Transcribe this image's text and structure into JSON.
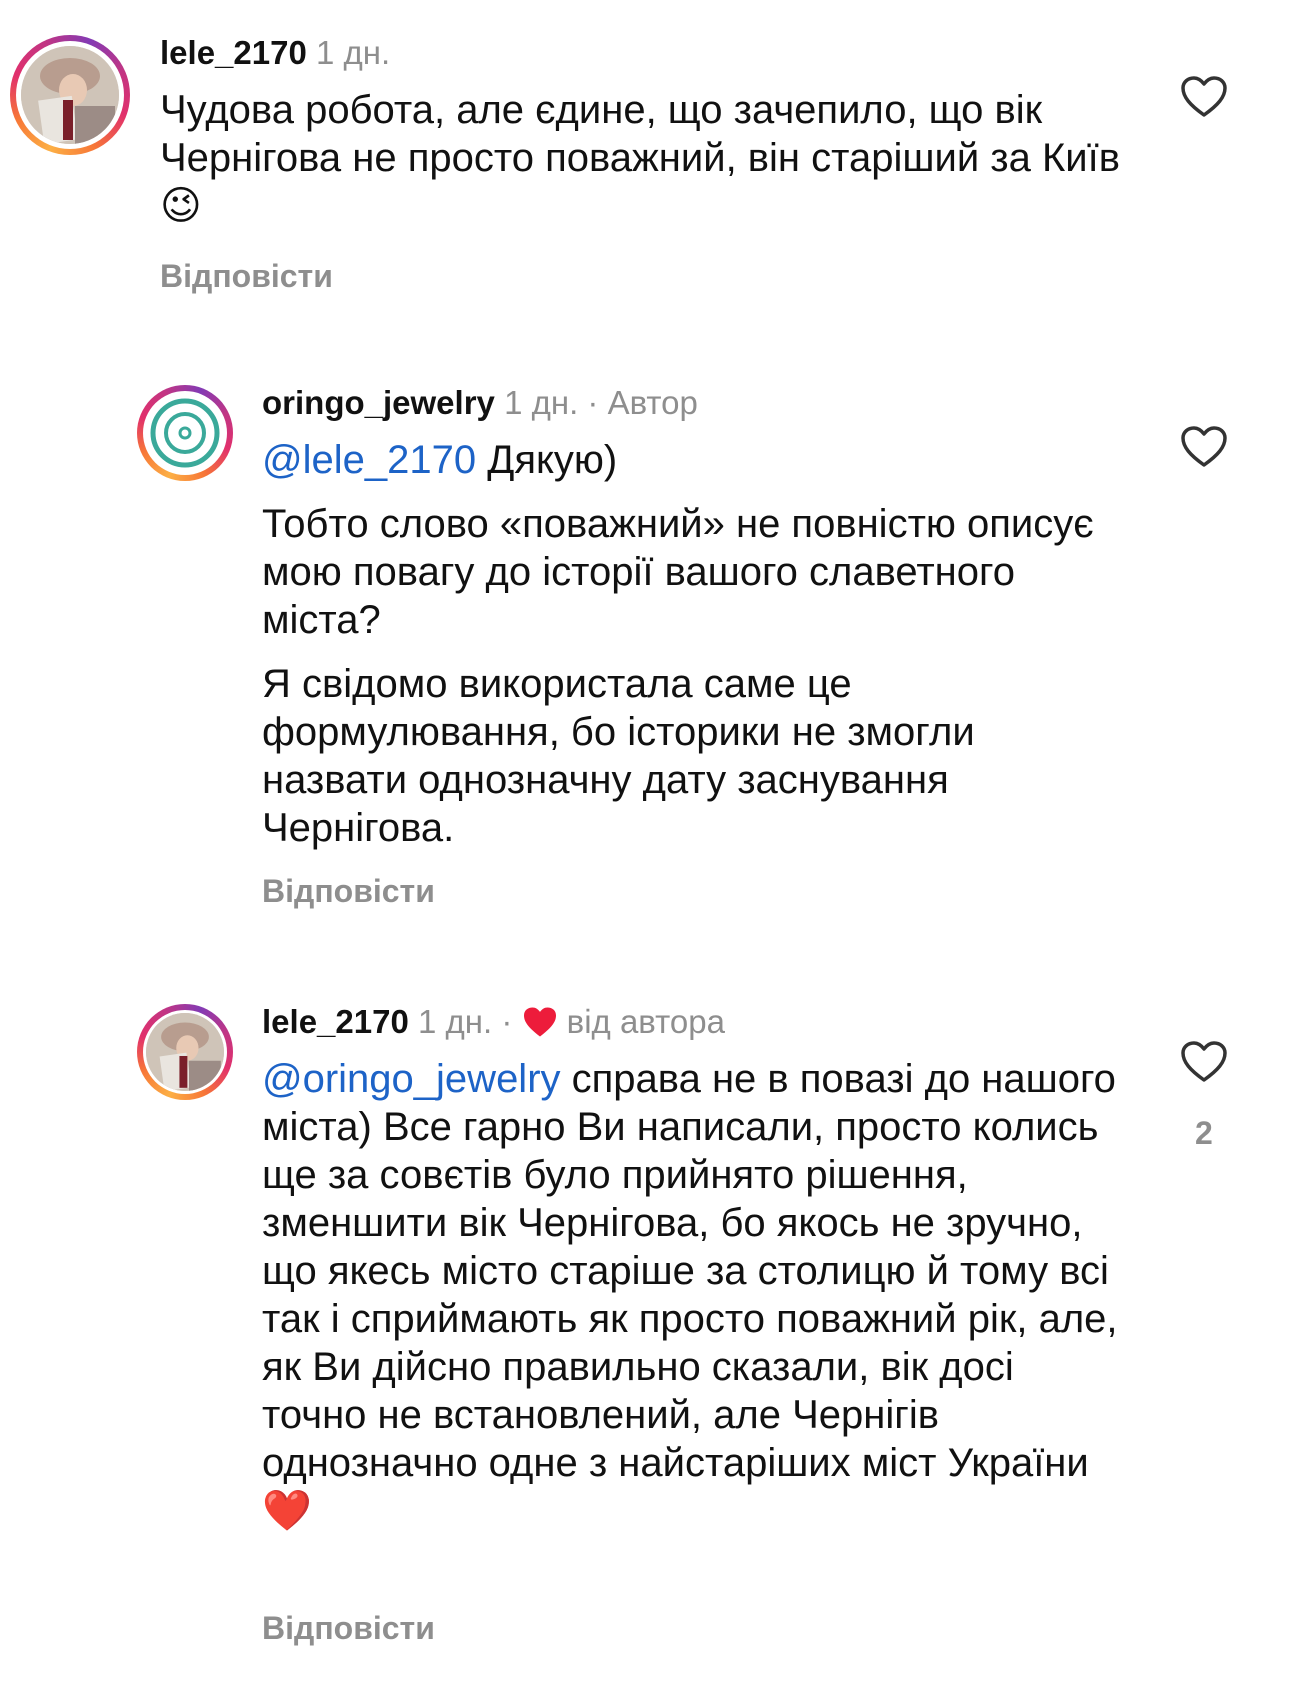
{
  "comments": [
    {
      "username": "lele_2170",
      "time": "1 дн.",
      "text": "Чудова робота, але єдине, що зачепило, що вік Чернігова не просто поважний, він старіший за Київ",
      "emoji": "😉",
      "reply_label": "Відповісти",
      "avatar": "woman-with-book-photo"
    },
    {
      "username": "oringo_jewelry",
      "time": "1 дн.",
      "separator": "·",
      "author_badge": "Автор",
      "mention": "@lele_2170",
      "text_after_mention": " Дякую)",
      "paragraph2": "Тобто слово «поважний» не повністю описує мою повагу до історії вашого славетного міста?",
      "paragraph3": "Я свідомо використала саме це формулювання, бо історики не змогли назвати однозначну дату заснування Чернігова.",
      "reply_label": "Відповісти",
      "avatar": "concentric-circles-logo"
    },
    {
      "username": "lele_2170",
      "time": "1 дн.",
      "separator": "·",
      "liked_by_author": "від автора",
      "mention": "@oringo_jewelry",
      "text_after_mention": " справа не в повазі до нашого міста) Все гарно Ви написали, просто колись ще за совєтів було прийнято рішення, зменшити вік Чернігова, бо якось не зручно, що якесь місто старіше за столицю й тому всі так і сприймають як просто поважний рік, але, як Ви дійсно правильно сказали, вік досі точно не встановлений, але Чернігів однозначно одне з найстаріших міст України",
      "emoji": "❤️",
      "like_count": "2",
      "reply_label": "Відповісти",
      "avatar": "woman-with-book-photo"
    }
  ],
  "colors": {
    "mention": "#1d63c7",
    "gray": "#8e8e8e",
    "heart": "#ed1c3b"
  }
}
